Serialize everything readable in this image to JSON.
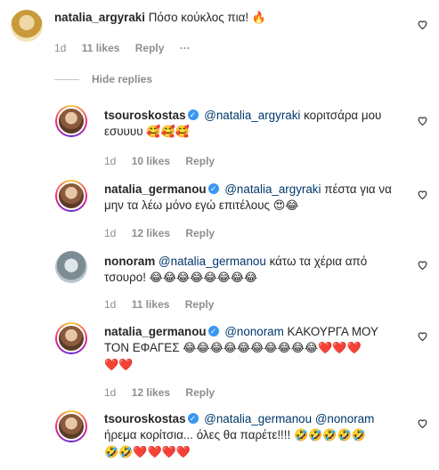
{
  "comments": [
    {
      "user": "natalia_argyraki",
      "text": "Πόσο κούκλος πια!",
      "emoji": "🔥",
      "time": "1d",
      "likes": "11 likes",
      "reply": "Reply",
      "more": "···"
    },
    {
      "user": "tsouroskostas",
      "mention": "@natalia_argyraki",
      "text": "κοριτσάρα μου",
      "line2": "εσυυυυ",
      "emoji": "🥰🥰🥰",
      "time": "1d",
      "likes": "10 likes",
      "reply": "Reply"
    },
    {
      "user": "natalia_germanou",
      "mention": "@natalia_argyraki",
      "text": "πέστα για να",
      "line2": "μην τα λέω μόνο εγώ επιτέλους",
      "emoji": "😍😂",
      "time": "1d",
      "likes": "12 likes",
      "reply": "Reply"
    },
    {
      "user": "nonoram",
      "mention": "@natalia_germanou",
      "text": "κάτω τα χέρια από",
      "line2": "τσουρο!",
      "emoji": "😂😂😂😂😂😂😂😂",
      "time": "1d",
      "likes": "11 likes",
      "reply": "Reply"
    },
    {
      "user": "natalia_germanou",
      "mention": "@nonoram",
      "text": "ΚΑΚΟΥΡΓΑ ΜΟΥ",
      "line2": "ΤΟΝ ΕΦΑΓΕΣ",
      "emoji": "😂😂😂😂😂😂😂😂😂😂❤️❤️❤️",
      "emoji2": "❤️❤️",
      "time": "1d",
      "likes": "12 likes",
      "reply": "Reply"
    },
    {
      "user": "tsouroskostas",
      "mention": "@natalia_germanou",
      "mention2": "@nonoram",
      "line2": "ήρεμα κορίτσια... όλες θα παρέτε!!!!",
      "emoji": "🤣🤣🤣🤣🤣",
      "emoji2": "🤣🤣❤️❤️❤️❤️"
    }
  ],
  "hide_replies": "Hide replies"
}
